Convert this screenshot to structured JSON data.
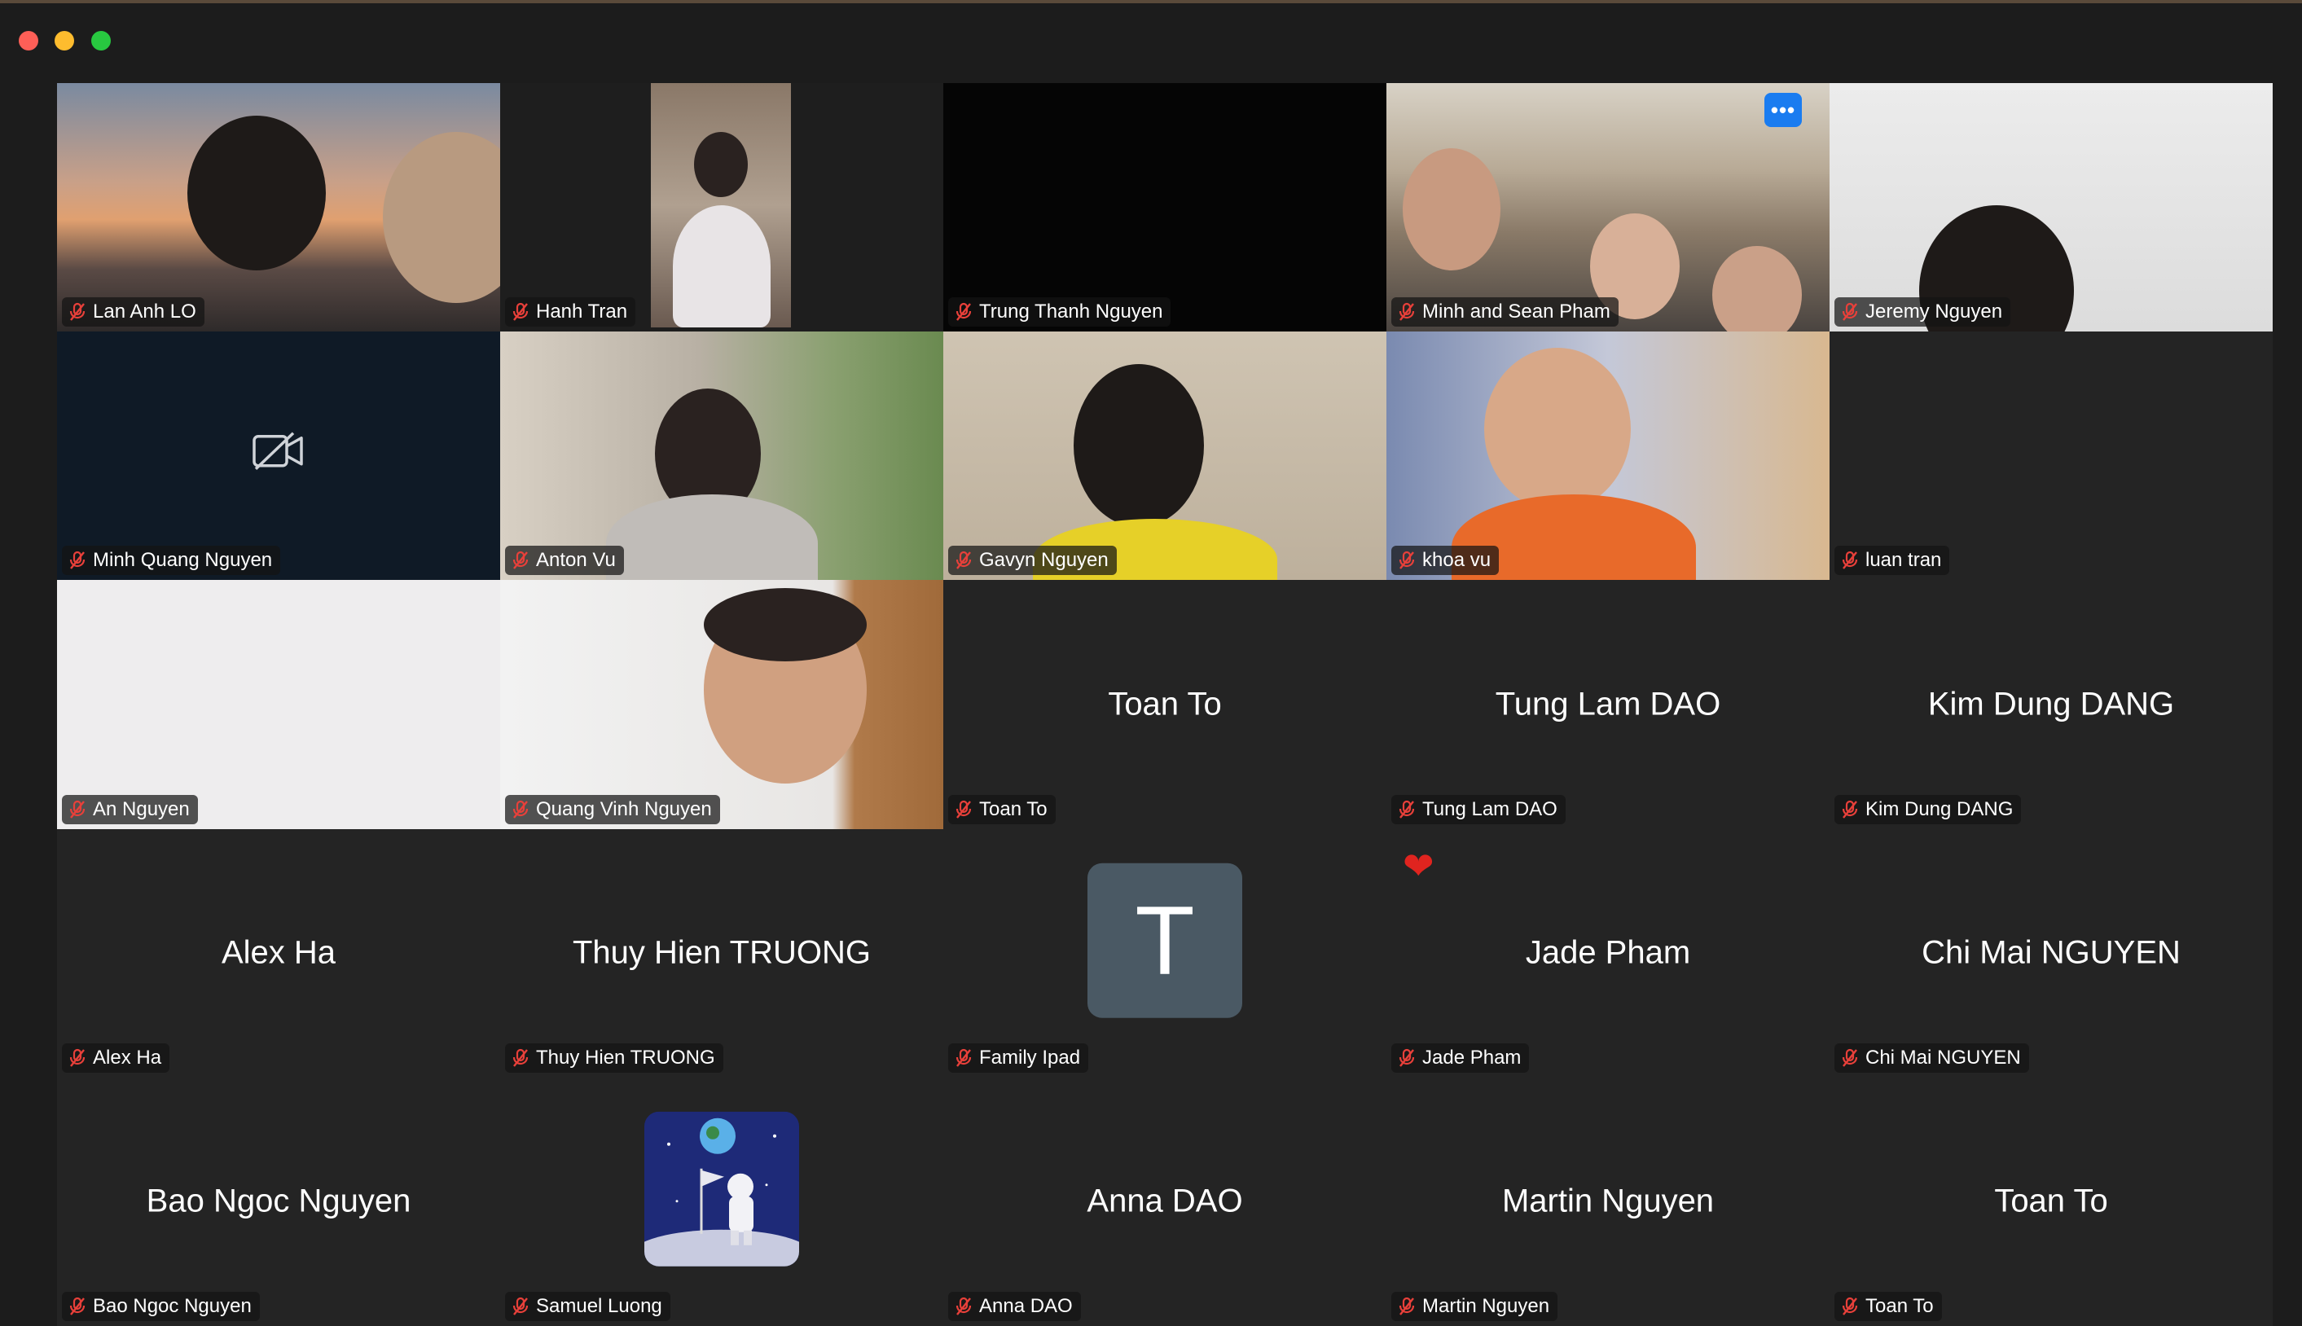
{
  "window": {
    "buttons": [
      "close",
      "minimize",
      "maximize"
    ]
  },
  "tiles": [
    {
      "name": "Lan Anh LO"
    },
    {
      "name": "Hanh Tran"
    },
    {
      "name": "Trung Thanh Nguyen"
    },
    {
      "name": "Minh and Sean Pham",
      "more": "•••"
    },
    {
      "name": "Jeremy Nguyen"
    },
    {
      "name": "Minh Quang Nguyen"
    },
    {
      "name": "Anton Vu"
    },
    {
      "name": "Gavyn Nguyen"
    },
    {
      "name": "khoa vu"
    },
    {
      "name": "luan tran"
    },
    {
      "name": "An Nguyen"
    },
    {
      "name": "Quang Vinh Nguyen"
    },
    {
      "name": "Toan To",
      "display": "Toan To"
    },
    {
      "name": "Tung Lam DAO",
      "display": "Tung Lam DAO"
    },
    {
      "name": "Kim Dung DANG",
      "display": "Kim Dung DANG"
    },
    {
      "name": "Alex Ha",
      "display": "Alex Ha"
    },
    {
      "name": "Thuy Hien TRUONG",
      "display": "Thuy Hien TRUONG"
    },
    {
      "name": "Family Ipad",
      "avatar_letter": "T"
    },
    {
      "name": "Jade Pham",
      "display": "Jade Pham",
      "reaction": "❤"
    },
    {
      "name": "Chi Mai NGUYEN",
      "display": "Chi Mai NGUYEN"
    },
    {
      "name": "Bao Ngoc Nguyen",
      "display": "Bao Ngoc Nguyen"
    },
    {
      "name": "Samuel Luong"
    },
    {
      "name": "Anna DAO",
      "display": "Anna DAO"
    },
    {
      "name": "Martin Nguyen",
      "display": "Martin Nguyen"
    },
    {
      "name": "Toan To",
      "display": "Toan To"
    }
  ],
  "icons": {
    "muted": "mic-off-icon",
    "camera_off": "camera-off-icon"
  },
  "colors": {
    "accent": "#1a7cf0",
    "muted_red": "#e8403a",
    "tile_bg": "#242424",
    "tag_bg": "#141414"
  }
}
